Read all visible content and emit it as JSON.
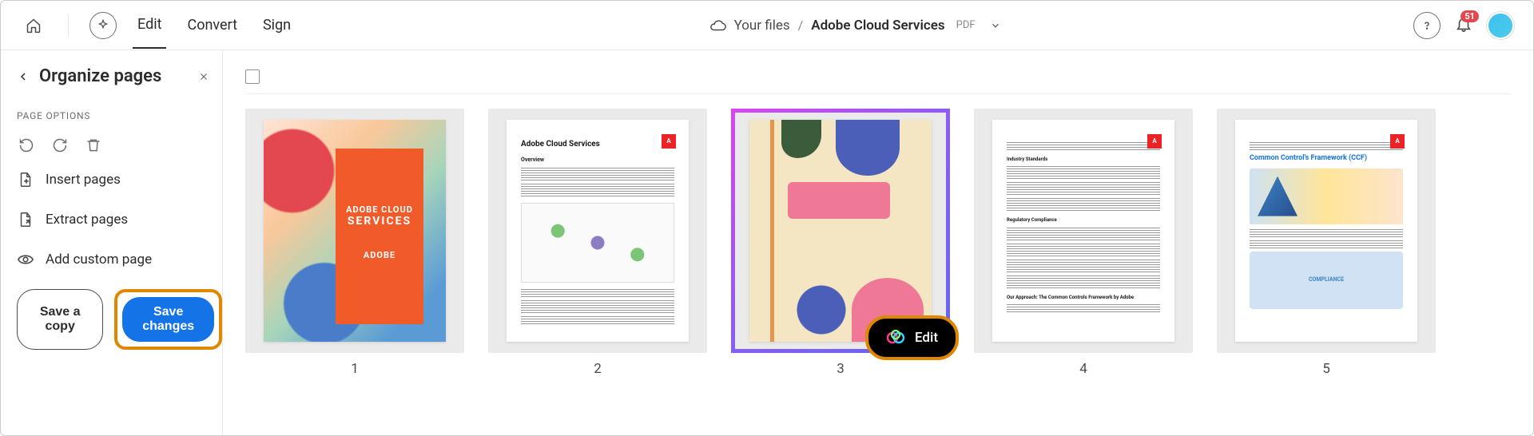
{
  "topbar": {
    "tabs": {
      "edit": "Edit",
      "convert": "Convert",
      "sign": "Sign"
    },
    "breadcrumb": {
      "root": "Your files",
      "sep": "/",
      "file": "Adobe Cloud Services",
      "type": "PDF"
    },
    "notifications": "51"
  },
  "sidebar": {
    "title": "Organize pages",
    "section_label": "PAGE OPTIONS",
    "actions": {
      "insert": "Insert pages",
      "extract": "Extract pages",
      "custom": "Add custom page"
    },
    "buttons": {
      "save_copy": "Save a copy",
      "save_changes": "Save changes"
    }
  },
  "pages": {
    "p1": {
      "num": "1",
      "title_line1": "ADOBE CLOUD",
      "title_line2": "SERVICES",
      "brand": "ADOBE"
    },
    "p2": {
      "num": "2",
      "heading": "Adobe Cloud Services",
      "sub": "Overview"
    },
    "p3": {
      "num": "3"
    },
    "p4": {
      "num": "4"
    },
    "p5": {
      "num": "5",
      "heading": "Common Control's Framework (CCF)",
      "box": "COMPLIANCE"
    }
  },
  "overlay": {
    "edit_label": "Edit"
  }
}
